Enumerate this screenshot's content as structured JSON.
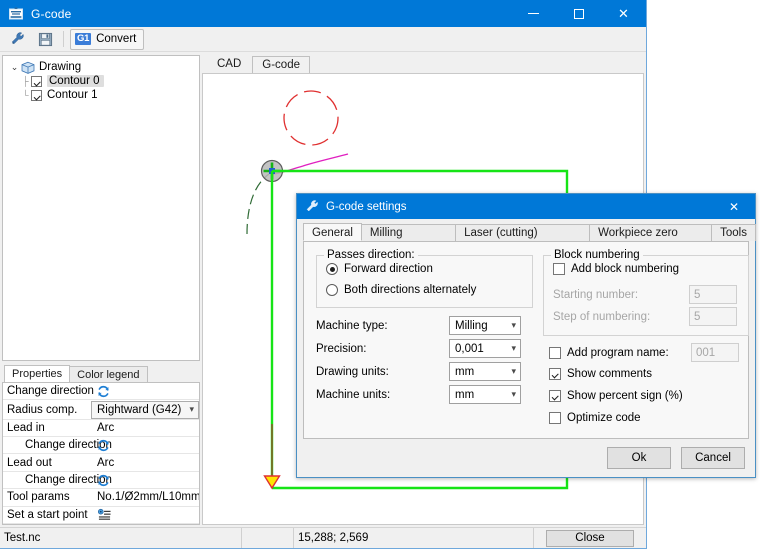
{
  "window": {
    "title": "G-code",
    "icon": "app-gcode-icon",
    "controls": {
      "minimize": "–",
      "maximize": "☐",
      "close": "✕"
    }
  },
  "toolbar": {
    "settings_icon": "wrench-icon",
    "save_icon": "save-icon",
    "convert_badge": "G1",
    "convert_label": "Convert"
  },
  "tree": {
    "root": {
      "label": "Drawing",
      "expanded": true,
      "chevron": "⌄"
    },
    "items": [
      {
        "label": "Contour 0",
        "checked": true,
        "selected": true
      },
      {
        "label": "Contour 1",
        "checked": true,
        "selected": false
      }
    ]
  },
  "properties_panel": {
    "tabs": [
      {
        "label": "Properties",
        "active": true
      },
      {
        "label": "Color legend",
        "active": false
      }
    ],
    "rows": [
      {
        "name": "Change direction",
        "value": "",
        "type": "icon",
        "icon": "refresh-icon",
        "indent": false
      },
      {
        "name": "Radius comp.",
        "value": "Rightward (G42)",
        "type": "combo",
        "indent": false
      },
      {
        "name": "Lead in",
        "value": "Arc",
        "type": "text",
        "indent": false
      },
      {
        "name": "Change direction",
        "value": "",
        "type": "icon",
        "icon": "refresh-icon",
        "indent": true
      },
      {
        "name": "Lead out",
        "value": "Arc",
        "type": "text",
        "indent": false
      },
      {
        "name": "Change direction",
        "value": "",
        "type": "icon",
        "icon": "refresh-icon",
        "indent": true
      },
      {
        "name": "Tool params",
        "value": "No.1/Ø2mm/L10mm",
        "type": "text",
        "indent": false
      },
      {
        "name": "Set a start point",
        "value": "",
        "type": "icon",
        "icon": "start-point-icon",
        "indent": false
      }
    ]
  },
  "cad": {
    "tabs": [
      {
        "label": "CAD",
        "active": true
      },
      {
        "label": "G-code",
        "active": false
      }
    ]
  },
  "statusbar": {
    "file": "Test.nc",
    "field2": "",
    "coords": "15,288; 2,569",
    "close_label": "Close"
  },
  "dialog": {
    "title": "G-code settings",
    "icon": "wrench-icon",
    "close_glyph": "✕",
    "tabs": [
      {
        "label": "General",
        "active": true
      },
      {
        "label": "Milling machine",
        "active": false
      },
      {
        "label": "Laser (cutting) machine",
        "active": false
      },
      {
        "label": "Workpiece zero point",
        "active": false
      },
      {
        "label": "Tools",
        "active": false
      }
    ],
    "passes_group": {
      "title": "Passes direction:",
      "options": [
        {
          "label": "Forward direction",
          "selected": true
        },
        {
          "label": "Both directions alternately",
          "selected": false
        }
      ]
    },
    "fields": [
      {
        "label": "Machine type:",
        "value": "Milling"
      },
      {
        "label": "Precision:",
        "value": "0,001"
      },
      {
        "label": "Drawing units:",
        "value": "mm"
      },
      {
        "label": "Machine units:",
        "value": "mm"
      }
    ],
    "block_group": {
      "title": "Block numbering",
      "checkbox": {
        "label": "Add block numbering",
        "checked": false
      },
      "rows": [
        {
          "label": "Starting number:",
          "value": "5",
          "disabled": true
        },
        {
          "label": "Step of numbering:",
          "value": "5",
          "disabled": true
        }
      ]
    },
    "options": [
      {
        "label": "Add program name:",
        "checked": false,
        "value": "001",
        "has_field": true,
        "disabled_field": true
      },
      {
        "label": "Show comments",
        "checked": true,
        "has_field": false
      },
      {
        "label": "Show percent sign (%)",
        "checked": true,
        "has_field": false
      },
      {
        "label": "Optimize code",
        "checked": false,
        "has_field": false
      }
    ],
    "buttons": {
      "ok": "Ok",
      "cancel": "Cancel"
    }
  },
  "colors": {
    "accent": "#0078d7",
    "toolpath_green": "#16e416",
    "lead_red": "#e03030",
    "lead_magenta": "#e020c0",
    "contour_dark": "#2f6b35",
    "arrow_yellow": "#ffe500",
    "dialog_border": "#4a90c4"
  }
}
